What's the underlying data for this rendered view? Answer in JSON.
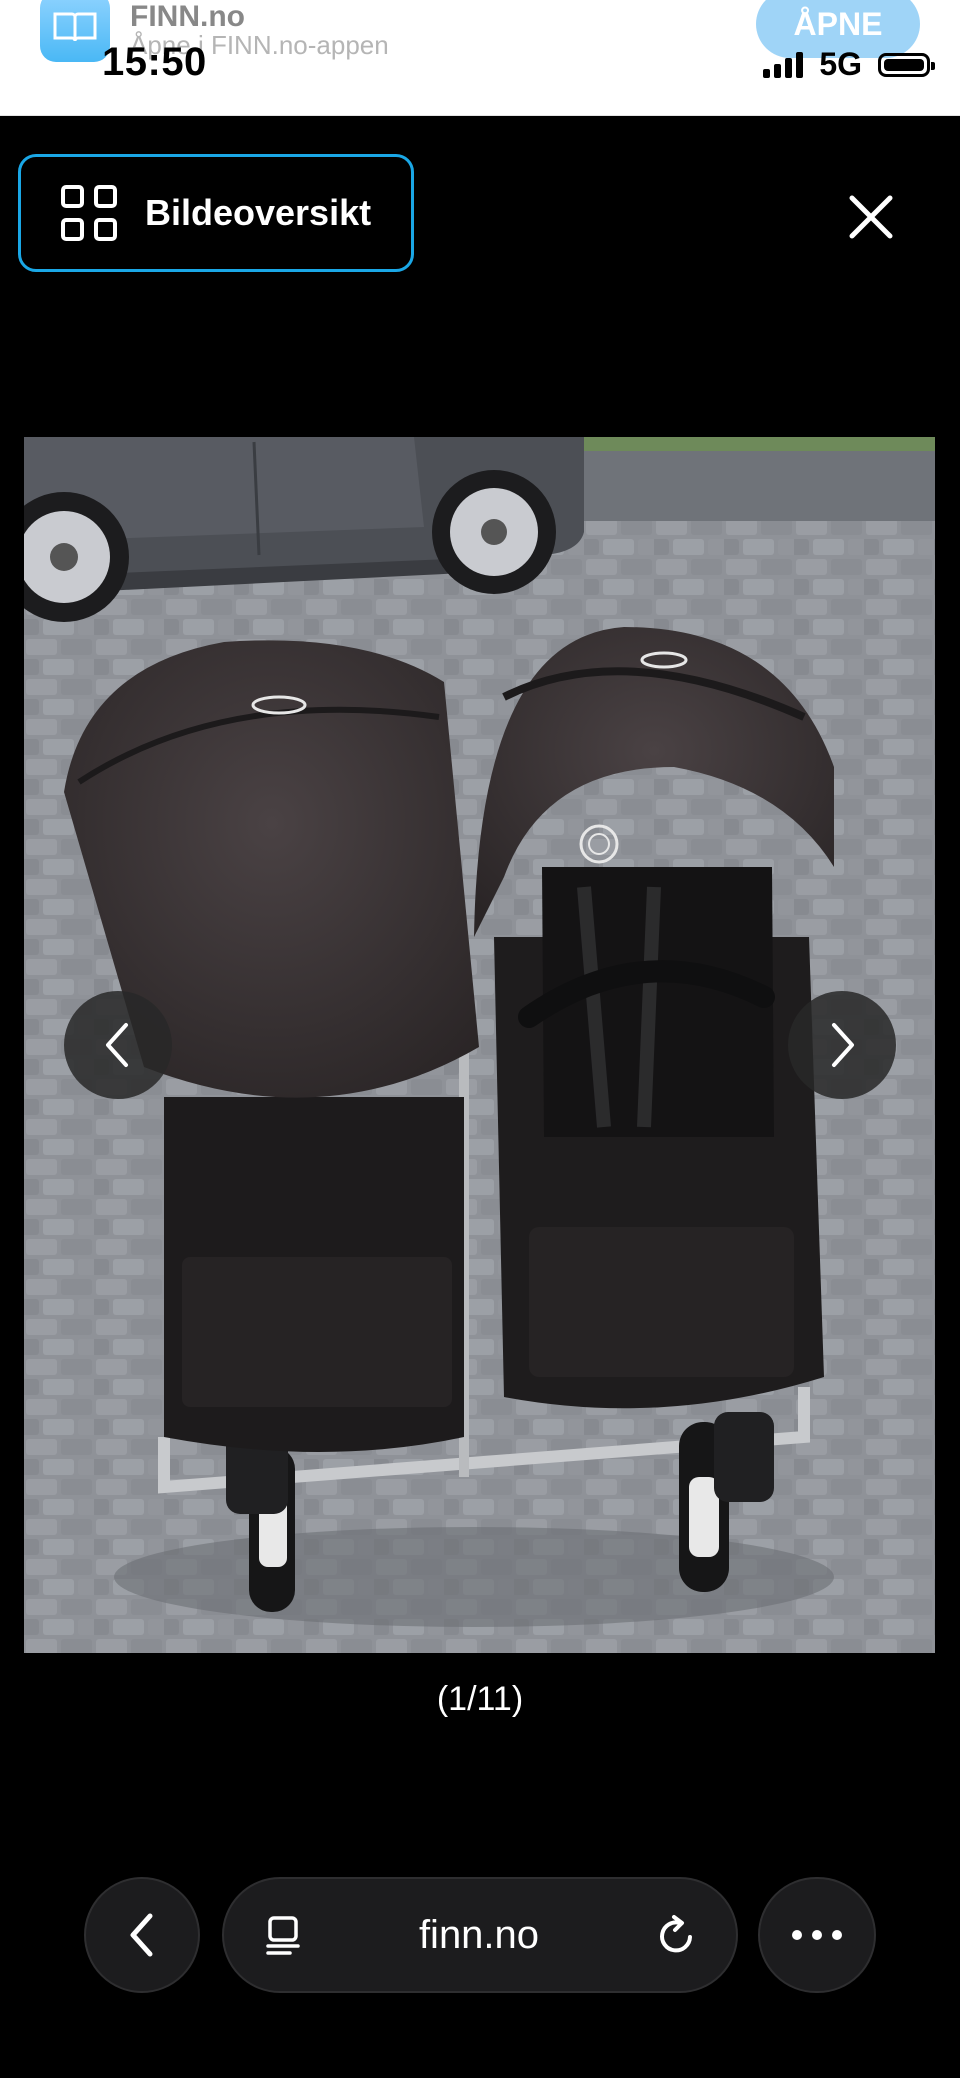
{
  "banner": {
    "app_name": "FINN.no",
    "app_subtitle": "Åpne i FINN.no-appen",
    "open_label": "ÅPNE"
  },
  "status_bar": {
    "time": "15:50",
    "network": "5G"
  },
  "viewer": {
    "overview_label": "Bildeoversikt",
    "counter": "(1/11)"
  },
  "browser": {
    "domain": "finn.no"
  },
  "colors": {
    "focus_ring": "#1aa7e6",
    "background": "#000000",
    "pill_bg": "#1c1c1e"
  },
  "icons": {
    "overview": "grid-icon",
    "close": "close-icon",
    "prev": "chevron-left-icon",
    "next": "chevron-right-icon",
    "reader": "page-icon",
    "reload": "reload-icon",
    "more": "more-icon"
  }
}
